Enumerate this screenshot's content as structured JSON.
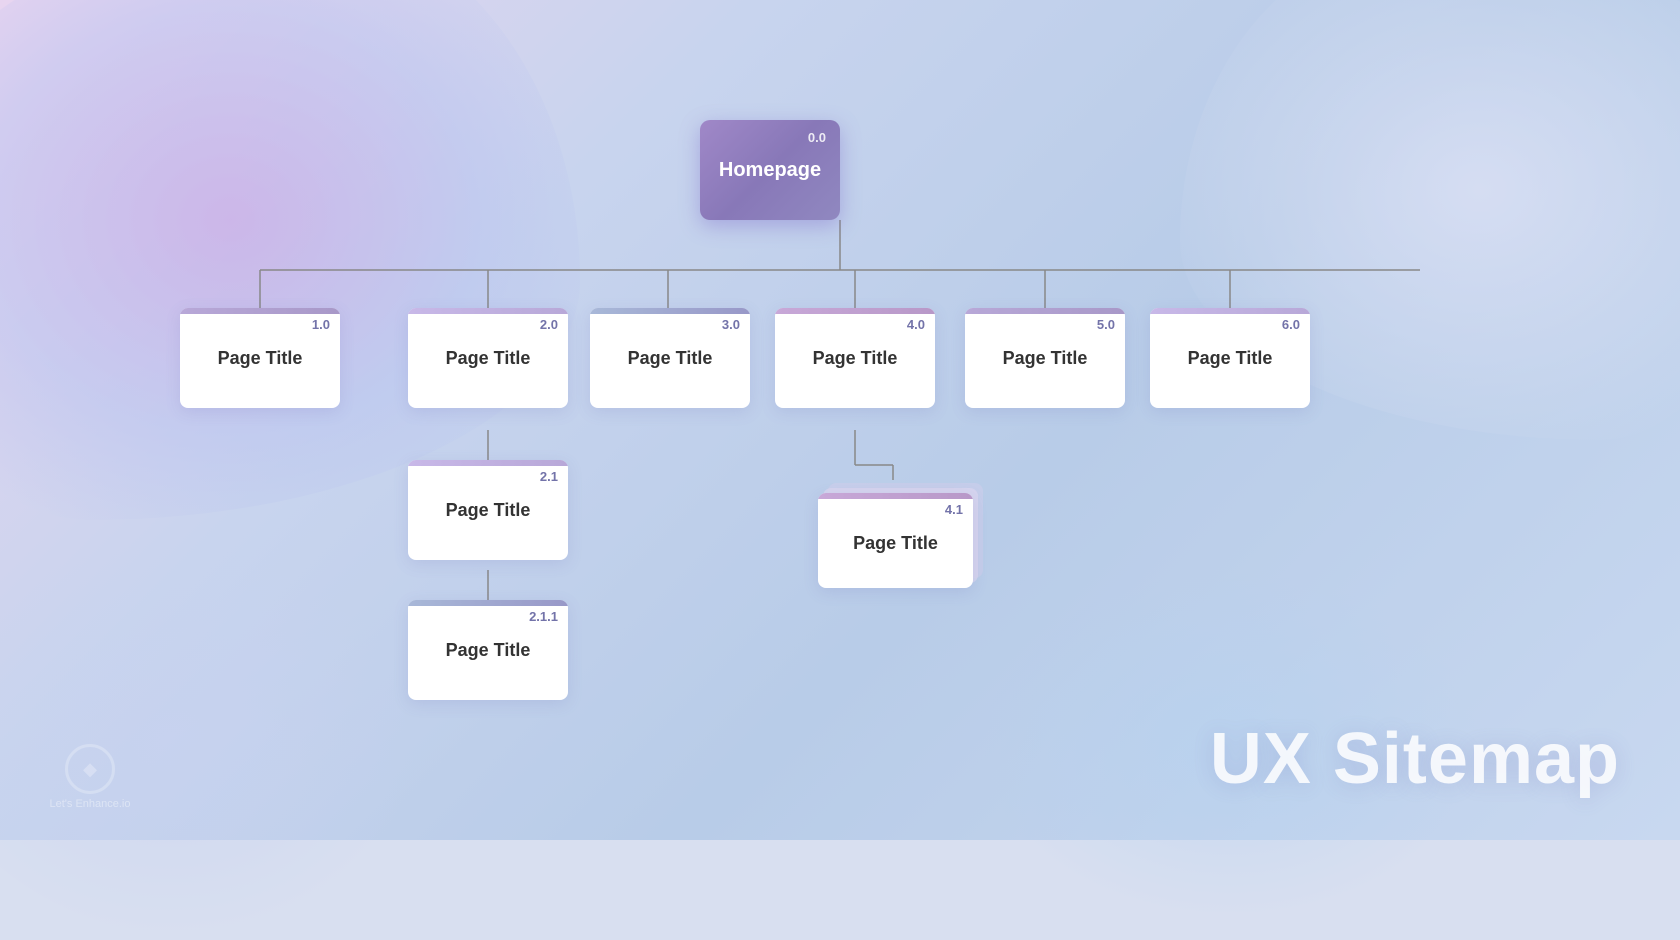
{
  "title": "UX Sitemap",
  "homepage": {
    "number": "0.0",
    "label": "Homepage"
  },
  "nodes": [
    {
      "id": "n1",
      "number": "1.0",
      "label": "Page Title"
    },
    {
      "id": "n2",
      "number": "2.0",
      "label": "Page Title"
    },
    {
      "id": "n3",
      "number": "3.0",
      "label": "Page Title"
    },
    {
      "id": "n4",
      "number": "4.0",
      "label": "Page Title"
    },
    {
      "id": "n5",
      "number": "5.0",
      "label": "Page Title"
    },
    {
      "id": "n6",
      "number": "6.0",
      "label": "Page Title"
    },
    {
      "id": "n21",
      "number": "2.1",
      "label": "Page Title"
    },
    {
      "id": "n211",
      "number": "2.1.1",
      "label": "Page Title"
    },
    {
      "id": "n41",
      "number": "4.1",
      "label": "Page Title"
    }
  ],
  "logo": {
    "text": "Let's Enhance.io"
  }
}
